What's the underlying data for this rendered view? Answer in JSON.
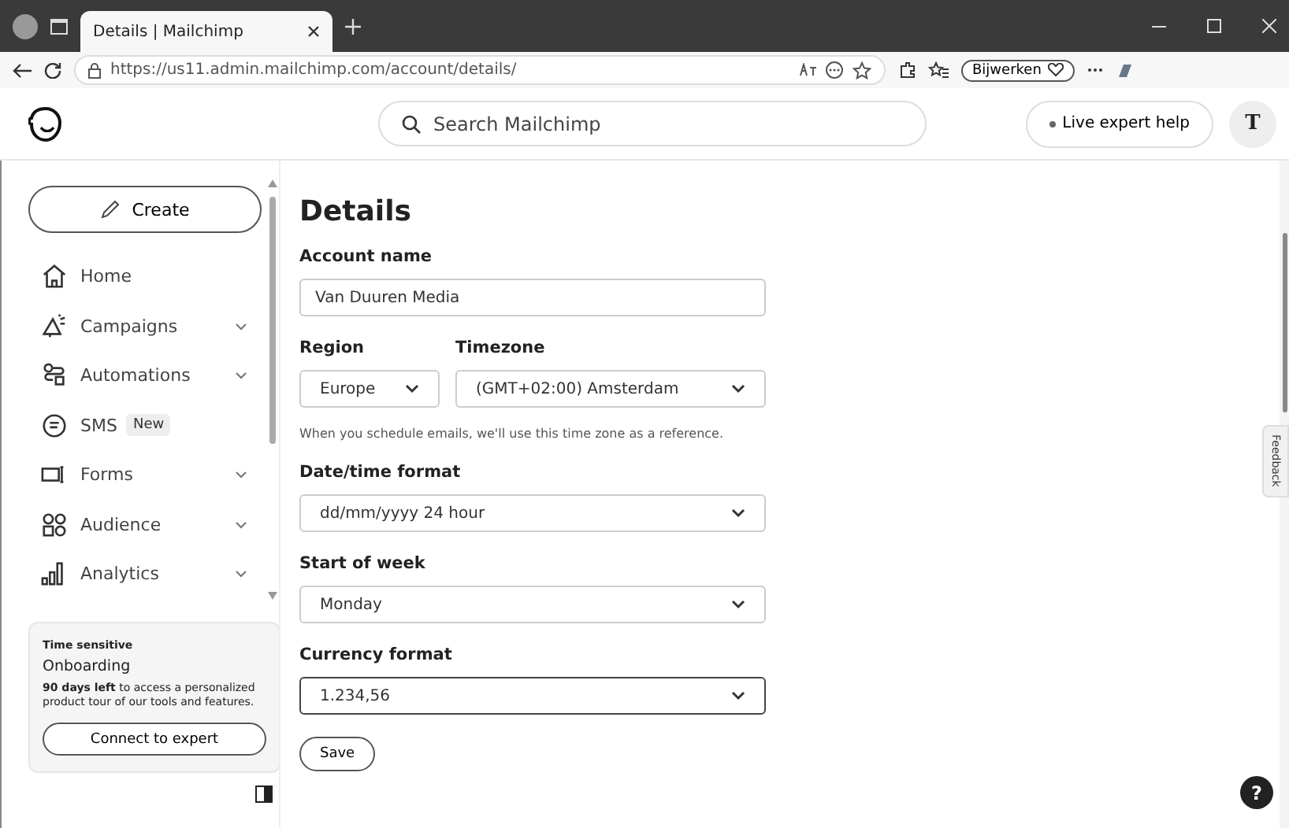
{
  "browser": {
    "tab_title": "Details | Mailchimp",
    "url": "https://us11.admin.mailchimp.com/account/details/",
    "update_button": "Bijwerken"
  },
  "header": {
    "search_placeholder": "Search Mailchimp",
    "help_button": "Live expert help",
    "avatar": "T"
  },
  "sidebar": {
    "create_button": "Create",
    "items": [
      {
        "label": "Home",
        "kind": "home",
        "has_submenu": false
      },
      {
        "label": "Campaigns",
        "kind": "megaphone",
        "has_submenu": true
      },
      {
        "label": "Automations",
        "kind": "flow",
        "has_submenu": true
      },
      {
        "label": "SMS",
        "kind": "chat",
        "has_submenu": false,
        "badge": "New"
      },
      {
        "label": "Forms",
        "kind": "form",
        "has_submenu": true
      },
      {
        "label": "Audience",
        "kind": "people",
        "has_submenu": true
      },
      {
        "label": "Analytics",
        "kind": "bars",
        "has_submenu": true
      }
    ],
    "promo": {
      "tag": "Time sensitive",
      "title": "Onboarding",
      "text": "**90 days left** to access a personalized product tour of our tools and features.",
      "button": "Connect to expert"
    }
  },
  "page": {
    "title": "Details",
    "account_name": {
      "label": "Account name",
      "value": "Van Duuren Media"
    },
    "region": {
      "label": "Region",
      "value": "Europe"
    },
    "timezone": {
      "label": "Timezone",
      "value": "(GMT+02:00) Amsterdam"
    },
    "timezone_hint": "When you schedule emails, we'll use this time zone as a reference.",
    "selects": [
      {
        "label": "Date/time format",
        "value": "dd/mm/yyyy 24 hour",
        "focused": false
      },
      {
        "label": "Start of week",
        "value": "Monday",
        "focused": false
      },
      {
        "label": "Currency format",
        "value": "1.234,56",
        "focused": true
      }
    ],
    "save_button": "Save"
  },
  "feedback_tab": "Feedback",
  "help_icon": "?"
}
